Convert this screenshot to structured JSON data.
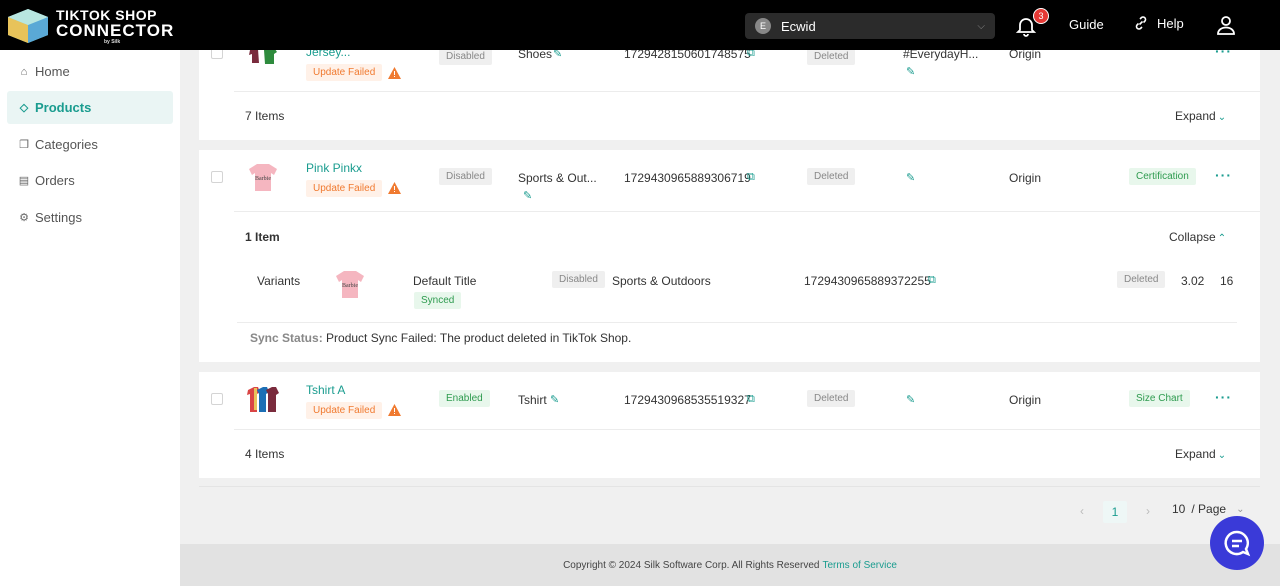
{
  "brand": {
    "line1": "TIKTOK SHOP",
    "line2": "CONNECTOR",
    "by": "by Silk"
  },
  "header": {
    "store": {
      "avatar_letter": "E",
      "name": "Ecwid"
    },
    "notifications_count": "3",
    "guide_label": "Guide",
    "help_label": "Help"
  },
  "sidebar": {
    "items": [
      {
        "label": "Home",
        "icon": "home-icon"
      },
      {
        "label": "Products",
        "icon": "tag-icon",
        "active": true
      },
      {
        "label": "Categories",
        "icon": "copy-icon"
      },
      {
        "label": "Orders",
        "icon": "box-icon"
      },
      {
        "label": "Settings",
        "icon": "gear-icon"
      }
    ]
  },
  "products": [
    {
      "name": "Jersey...",
      "status_tag": "Update Failed",
      "state": "Disabled",
      "category": "Shoes",
      "tiktok_id": "1729428150601748575",
      "sync": "Deleted",
      "note": "#EverydayH...",
      "origin": "Origin",
      "items_label": "7 Items",
      "toggle_label": "Expand"
    },
    {
      "name": "Pink Pinkx",
      "status_tag": "Update Failed",
      "state": "Disabled",
      "category": "Sports & Out...",
      "tiktok_id": "1729430965889306719",
      "sync": "Deleted",
      "origin": "Origin",
      "extra_tag": "Certification",
      "items_label": "1 Item",
      "toggle_label": "Collapse",
      "variant": {
        "label": "Variants",
        "title": "Default Title",
        "title_tag": "Synced",
        "state": "Disabled",
        "category": "Sports & Outdoors",
        "tiktok_id": "1729430965889372255",
        "sync": "Deleted",
        "price": "3.02",
        "qty": "16"
      },
      "sync_status_label": "Sync Status:",
      "sync_status_text": "Product Sync Failed: The product deleted in TikTok Shop."
    },
    {
      "name": "Tshirt A",
      "status_tag": "Update Failed",
      "state": "Enabled",
      "category": "Tshirt",
      "tiktok_id": "1729430968535519327",
      "sync": "Deleted",
      "origin": "Origin",
      "extra_tag": "Size Chart",
      "items_label": "4 Items",
      "toggle_label": "Expand"
    }
  ],
  "pagination": {
    "current": "1",
    "page_size": "10",
    "page_size_suffix": "/ Page"
  },
  "footer": {
    "copyright": "Copyright © 2024 Silk Software Corp. All Rights Reserved",
    "tos_label": "Terms of Service"
  },
  "colors": {
    "accent": "#1a9c8f",
    "warning": "#f07a30",
    "chat": "#3a3ad8"
  }
}
